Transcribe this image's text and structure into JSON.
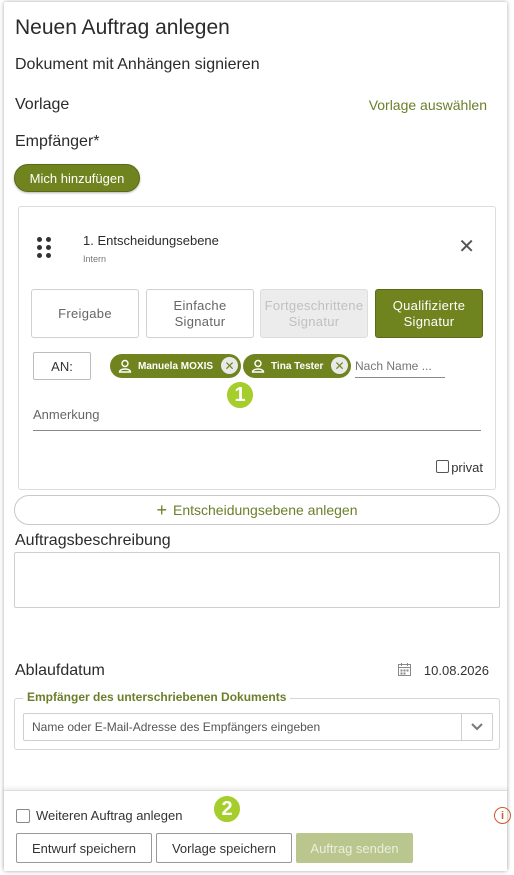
{
  "header": {
    "title": "Neuen Auftrag anlegen",
    "subtitle": "Dokument mit Anhängen signieren"
  },
  "template": {
    "label": "Vorlage",
    "select_link": "Vorlage auswählen"
  },
  "recipients": {
    "label": "Empfänger*",
    "add_me_button": "Mich hinzufügen"
  },
  "decision_level": {
    "title": "1. Entscheidungsebene",
    "type": "Intern",
    "signature_options": [
      {
        "label": "Freigabe",
        "state": "default"
      },
      {
        "label": "Einfache Signatur",
        "state": "default"
      },
      {
        "label": "Fortgeschrittene Signatur",
        "state": "disabled"
      },
      {
        "label": "Qualifizierte Signatur",
        "state": "selected"
      }
    ],
    "to_button": "AN:",
    "chips": [
      "Manuela MOXIS",
      "Tina Tester"
    ],
    "name_placeholder": "Nach Name ...",
    "remark_placeholder": "Anmerkung",
    "private_label": "privat"
  },
  "callouts": [
    "1",
    "2"
  ],
  "add_level_button": "Entscheidungsebene anlegen",
  "description": {
    "label": "Auftragsbeschreibung"
  },
  "expiry": {
    "label": "Ablaufdatum",
    "date": "10.08.2026"
  },
  "signed_doc_recipient": {
    "legend": "Empfänger des unterschriebenen Dokuments",
    "placeholder": "Name oder E-Mail-Adresse des Empfängers eingeben"
  },
  "footer": {
    "another_order_label": "Weiteren Auftrag anlegen",
    "save_draft": "Entwurf speichern",
    "save_template": "Vorlage speichern",
    "send_order": "Auftrag senden"
  },
  "colors": {
    "accent": "#6f841f",
    "link": "#6b7f2a",
    "callout": "#a5cd2b",
    "info": "#d2582a"
  }
}
